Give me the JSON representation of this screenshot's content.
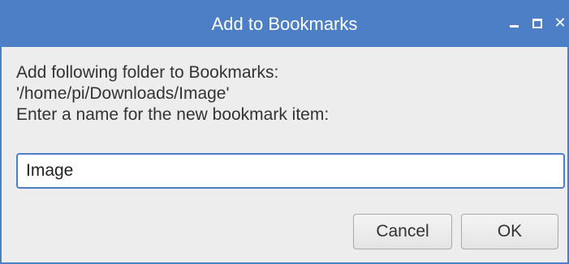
{
  "window": {
    "title": "Add to Bookmarks",
    "controls": {
      "minimize": "minimize-icon",
      "maximize": "maximize-icon",
      "close": "close-icon",
      "close_glyph": "✕"
    },
    "accent_color": "#4d7fc6"
  },
  "message": {
    "line1": "Add following folder to Bookmarks:",
    "line2": "'/home/pi/Downloads/Image'",
    "line3": "Enter a name for the new bookmark item:"
  },
  "name_input": {
    "value": "Image"
  },
  "buttons": {
    "cancel_label": "Cancel",
    "ok_label": "OK"
  }
}
